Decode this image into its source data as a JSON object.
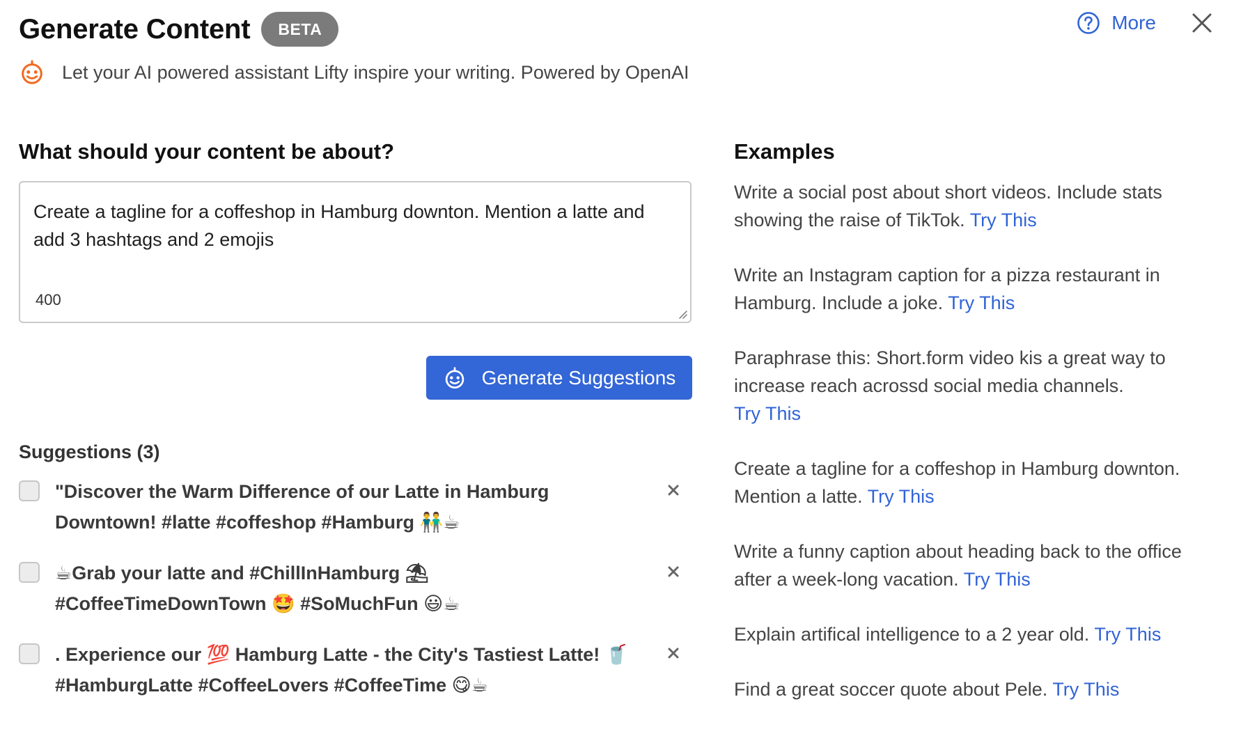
{
  "header": {
    "title": "Generate Content",
    "badge": "BETA",
    "subtitle": "Let your AI powered assistant Lifty inspire your writing. Powered by OpenAI",
    "more_label": "More"
  },
  "prompt": {
    "heading": "What should your content be about?",
    "value": "Create a tagline for a coffeshop in Hamburg downton. Mention a latte and add 3 hashtags and 2 emojis",
    "char_count": "400"
  },
  "generate_button": {
    "label": "Generate Suggestions"
  },
  "suggestions": {
    "heading": "Suggestions (3)",
    "items": [
      {
        "text": "\"Discover the Warm Difference of our Latte in Hamburg Downtown! #latte #coffeshop #Hamburg 👬☕"
      },
      {
        "text": "☕Grab your latte and #ChillInHamburg ⛱ #CoffeeTimeDownTown 🤩 #SoMuchFun 😃☕"
      },
      {
        "text": ". Experience our 💯 Hamburg Latte - the City's Tastiest Latte! 🥤 #HamburgLatte #CoffeeLovers #CoffeeTime 😋☕"
      }
    ]
  },
  "examples": {
    "heading": "Examples",
    "try_label": "Try This",
    "items": [
      {
        "text": "Write a social post about short videos. Include stats showing the raise of TikTok."
      },
      {
        "text": "Write an Instagram caption for a pizza restaurant in Hamburg. Include a joke."
      },
      {
        "text": "Paraphrase this: Short.form video kis a great way to increase reach acrossd social media channels."
      },
      {
        "text": "Create a tagline for a coffeshop in Hamburg downton. Mention a latte."
      },
      {
        "text": "Write a funny caption about heading back to the office after a week-long vacation."
      },
      {
        "text": "Explain artifical intelligence to a 2 year old."
      },
      {
        "text": "Find a great soccer quote about Pele."
      }
    ]
  },
  "colors": {
    "accent": "#3366d6",
    "link": "#2f63d6",
    "badge": "#7b7b7b",
    "logo": "#f26a21"
  },
  "icons": {
    "logo": "lifty-robot-icon",
    "help": "question-circle-icon",
    "close": "close-icon",
    "remove": "x-icon"
  }
}
